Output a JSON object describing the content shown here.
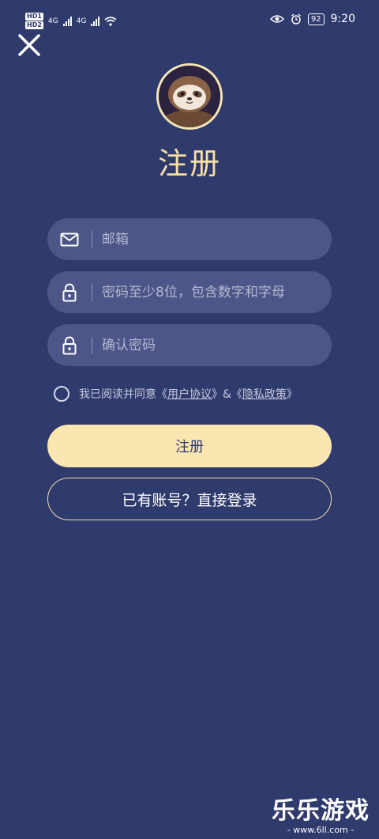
{
  "status_bar": {
    "hd1": "HD1",
    "hd2": "HD2",
    "net1": "4G",
    "net2": "4G",
    "battery": "92",
    "time": "9:20"
  },
  "header": {
    "title": "注册"
  },
  "form": {
    "email_placeholder": "邮箱",
    "password_placeholder": "密码至少8位，包含数字和字母",
    "confirm_placeholder": "确认密码"
  },
  "agreement": {
    "prefix": "我已阅读并同意《",
    "user_agreement": "用户协议",
    "middle": "》&《",
    "privacy_policy": "隐私政策",
    "suffix": "》"
  },
  "buttons": {
    "register": "注册",
    "login": "已有账号？直接登录"
  },
  "watermark": {
    "title": "乐乐游戏",
    "url": "- www.6ll.com -"
  },
  "colors": {
    "background": "#2f3a6d",
    "accent": "#f7dfa4",
    "field_bg": "#4d5688"
  }
}
